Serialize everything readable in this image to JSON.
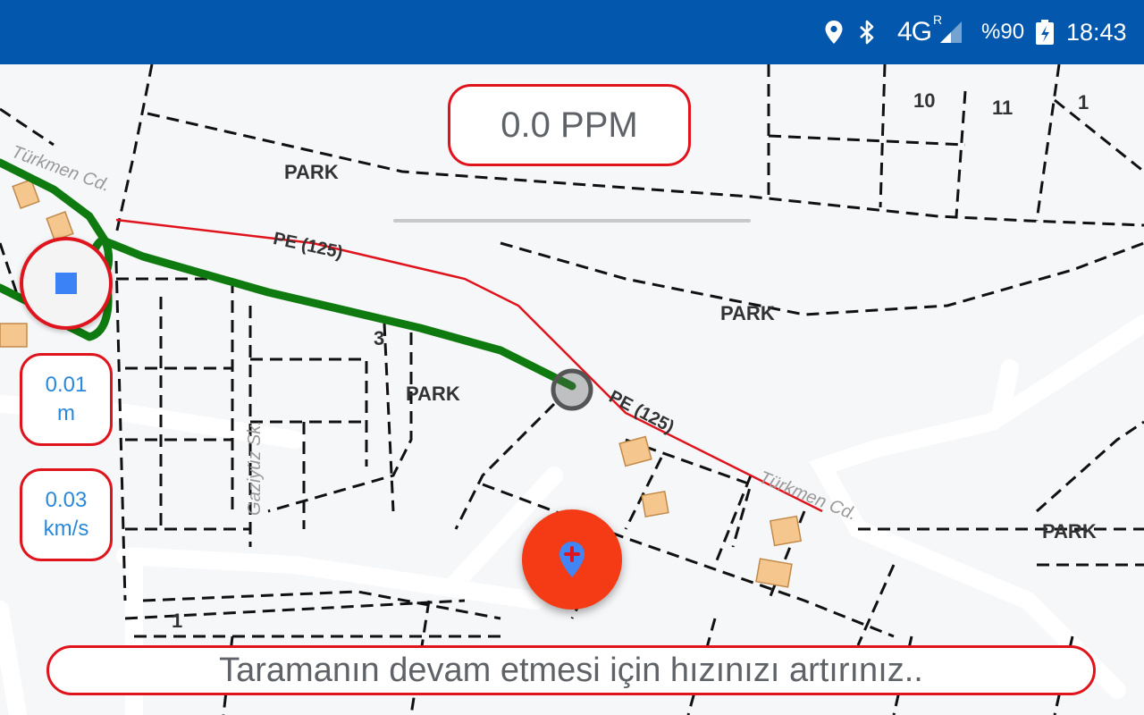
{
  "status_bar": {
    "network": "4G",
    "network_superscript": "R",
    "battery": "%90",
    "time": "18:43",
    "background_color": "#0358ad",
    "icons": [
      "location-icon",
      "bluetooth-icon",
      "signal-icon",
      "battery-icon"
    ]
  },
  "readout": {
    "ppm": "0.0 PPM"
  },
  "stats": {
    "distance_value": "0.01",
    "distance_unit": "m",
    "speed_value": "0.03",
    "speed_unit": "km/s"
  },
  "message": "Taramanın devam etmesi için hızınızı artırınız..",
  "map": {
    "labels": {
      "park1": "PARK",
      "park2": "PARK",
      "park3": "PARK",
      "park4": "PARK",
      "pipe1": "PE (125)",
      "pipe2": "PE (125)",
      "street1": "Türkmen Cd.",
      "street2": "Türkmen Cd.",
      "street3": "Gaziyüz Sk.",
      "num_10": "10",
      "num_11": "11",
      "num_1a": "1",
      "num_3": "3",
      "num_1b": "1"
    },
    "colors": {
      "track": "#0f7a0f",
      "pipe": "#e0141c",
      "accent": "#e0141c",
      "fab": "#f53b16",
      "stop_square": "#3b82f6"
    }
  },
  "controls": {
    "stop_icon": "stop-icon",
    "fab_icon": "add-location-icon"
  }
}
